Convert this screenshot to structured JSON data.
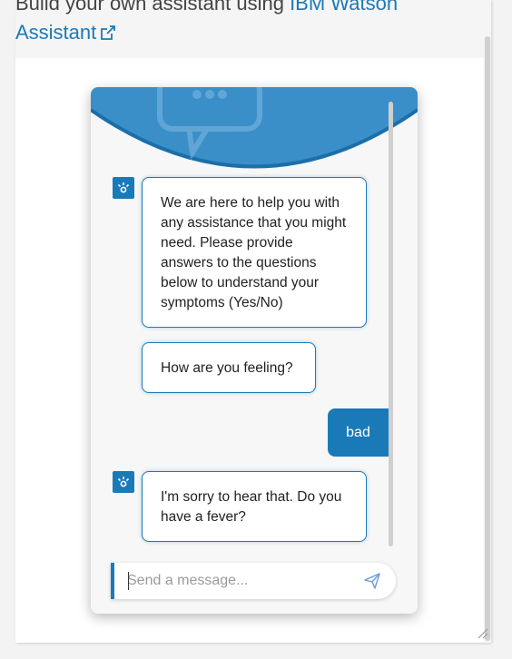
{
  "header": {
    "title_prefix": "Build your own assistant using ",
    "title_link": "IBM Watson",
    "title_link_line2": "Assistant"
  },
  "chat": {
    "messages": [
      {
        "from": "bot",
        "text": "We are here to help you with any assistance that you might need. Please provide answers to the questions below to understand your symptoms (Yes/No)"
      },
      {
        "from": "bot",
        "text": "How are you feeling?"
      },
      {
        "from": "user",
        "text": "bad"
      },
      {
        "from": "bot",
        "text": "I'm sorry to hear that. Do you have a fever?"
      }
    ],
    "input": {
      "placeholder": "Send a message...",
      "value": ""
    }
  },
  "colors": {
    "accent": "#1a7ab8",
    "header_wave": "#3a8fc9"
  },
  "icons": {
    "link": "external-link-icon",
    "avatar": "watson-bot-icon",
    "send": "send-icon",
    "header": "chat-bubble-icon"
  }
}
